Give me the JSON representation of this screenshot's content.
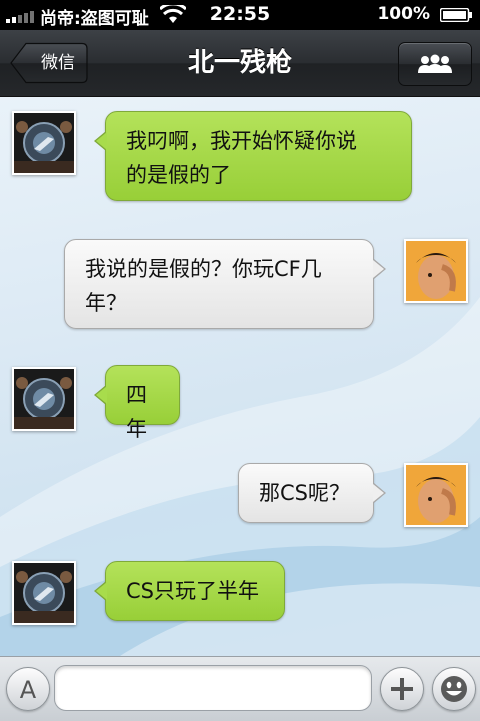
{
  "status_bar": {
    "carrier": "尚帝:盗图可耻",
    "time": "22:55",
    "battery": "100%"
  },
  "nav": {
    "back_label": "微信",
    "title": "北一残枪",
    "back_icon": "chevron-left-icon",
    "group_icon": "group-people-icon"
  },
  "messages": [
    {
      "side": "left",
      "text_lines": [
        "我叼啊，我开始怀疑你说",
        "的是假的了"
      ]
    },
    {
      "side": "right",
      "text_lines": [
        "我说的是假的？你玩CF几",
        "年？"
      ]
    },
    {
      "side": "left",
      "text_lines": [
        "四年"
      ]
    },
    {
      "side": "right",
      "text_lines": [
        "那CS呢？"
      ]
    },
    {
      "side": "left",
      "text_lines": [
        "CS只玩了半年"
      ]
    }
  ],
  "input_bar": {
    "voice_button_letter": "A",
    "text_value": "",
    "add_icon": "plus-icon",
    "emoji_icon": "smiley-icon"
  },
  "colors": {
    "green_bubble": "#a8dc4c",
    "gray_bubble": "#efefef",
    "navbar": "#2a2d31"
  }
}
